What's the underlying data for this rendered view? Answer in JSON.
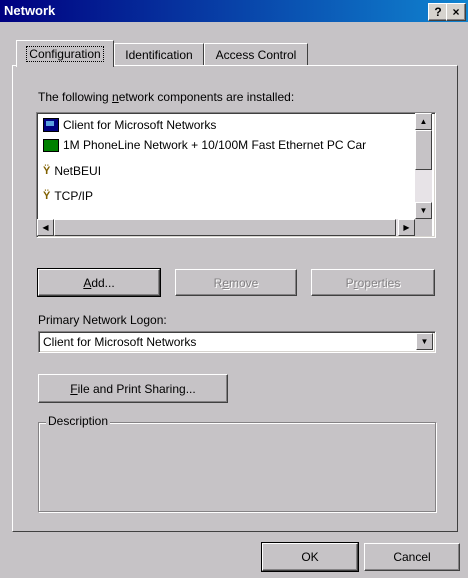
{
  "window": {
    "title": "Network",
    "help_button": "?",
    "close_button": "×"
  },
  "tabs": [
    {
      "label": "Configuration",
      "active": true
    },
    {
      "label": "Identification",
      "active": false
    },
    {
      "label": "Access Control",
      "active": false
    }
  ],
  "components": {
    "label_pre": "The following ",
    "label_u": "n",
    "label_post": "etwork components are installed:",
    "items": [
      {
        "label": "Client for Microsoft Networks",
        "icon": "network-client-icon"
      },
      {
        "label": "1M PhoneLine Network + 10/100M Fast Ethernet PC Car",
        "icon": "network-adapter-icon"
      },
      {
        "label": "NetBEUI",
        "icon": "protocol-icon"
      },
      {
        "label": "TCP/IP",
        "icon": "protocol-icon"
      }
    ]
  },
  "buttons": {
    "add_u": "A",
    "add_rest": "dd...",
    "remove_pre": "R",
    "remove_u": "e",
    "remove_rest": "move",
    "properties_pre": "P",
    "properties_u": "r",
    "properties_rest": "operties",
    "file_print_u": "F",
    "file_print_rest": "ile and Print Sharing...",
    "ok": "OK",
    "cancel": "Cancel"
  },
  "logon": {
    "label": "Primary Network Logon:",
    "value": "Client for Microsoft Networks"
  },
  "description": {
    "label": "Description"
  },
  "colors": {
    "title_start": "#000080",
    "title_end": "#1084d0",
    "face": "#c6c3c6"
  }
}
